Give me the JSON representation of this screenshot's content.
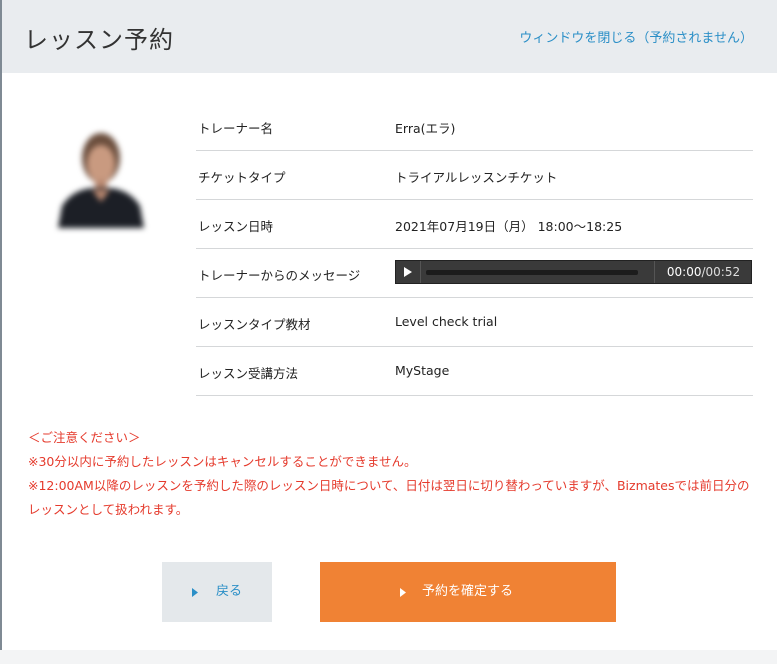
{
  "header": {
    "title": "レッスン予約",
    "close_link": "ウィンドウを閉じる（予約されません）"
  },
  "trainer_photo": {
    "description": "trainer-avatar"
  },
  "info_rows": [
    {
      "label": "トレーナー名",
      "value": "Erra(エラ)"
    },
    {
      "label": "チケットタイプ",
      "value": "トライアルレッスンチケット"
    },
    {
      "label": "レッスン日時",
      "value": "2021年07月19日（月） 18:00〜18:25"
    },
    {
      "label": "トレーナーからのメッセージ",
      "value": ""
    },
    {
      "label": "レッスンタイプ教材",
      "value": "Level check trial"
    },
    {
      "label": "レッスン受講方法",
      "value": "MyStage"
    }
  ],
  "audio_player": {
    "current_time": "00:00",
    "separator": "/",
    "duration": "00:52",
    "progress": 0
  },
  "notice": {
    "heading": "＜ご注意ください＞",
    "line1": "※30分以内に予約したレッスンはキャンセルすることができません。",
    "line2": "※12:00AM以降のレッスンを予約した際のレッスン日時について、日付は翌日に切り替わっていますが、Bizmatesでは前日分のレッスンとして扱われます。"
  },
  "buttons": {
    "back_label": "戻る",
    "confirm_label": "予約を確定する"
  },
  "colors": {
    "accent_blue": "#2b8fc7",
    "confirm_orange": "#f08234",
    "notice_red": "#e53a2c",
    "header_bg": "#e9ecef"
  }
}
